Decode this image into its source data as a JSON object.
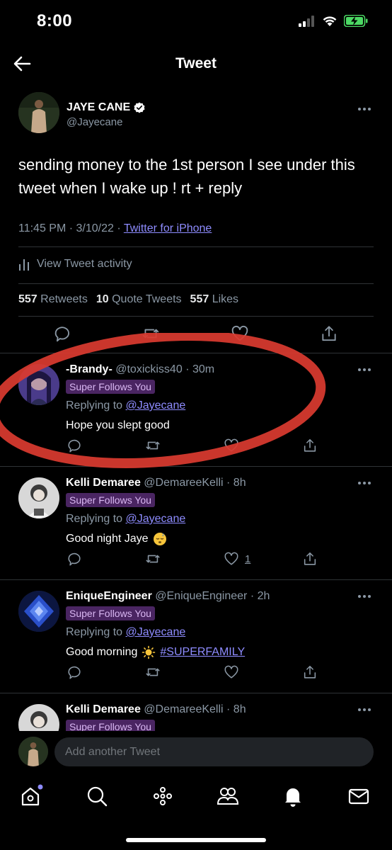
{
  "status_bar": {
    "time": "8:00"
  },
  "nav": {
    "title": "Tweet"
  },
  "tweet": {
    "author_name": "JAYE CANE",
    "author_handle": "@Jayecane",
    "text": "sending money to the 1st person I see under this tweet when I wake up ! rt + reply",
    "time_date": "11:45 PM · 3/10/22 · ",
    "source": "Twitter for iPhone",
    "activity_label": "View Tweet activity",
    "stats": {
      "retweets_count": "557",
      "retweets_label": "Retweets",
      "quotes_count": "10",
      "quotes_label": "Quote Tweets",
      "likes_count": "557",
      "likes_label": "Likes"
    }
  },
  "replies": [
    {
      "name": "-Brandy-",
      "handle": "@toxickiss40",
      "time": "· 30m",
      "badge": "Super Follows You",
      "replying_prefix": "Replying to ",
      "replying_to": "@Jayecane",
      "text": "Hope you slept good",
      "likes": ""
    },
    {
      "name": "Kelli Demaree",
      "handle": "@DemareeKelli",
      "time": "· 8h",
      "badge": "Super Follows You",
      "replying_prefix": "Replying to ",
      "replying_to": "@Jayecane",
      "text": "Good night Jaye",
      "likes": "1"
    },
    {
      "name": "EniqueEngineer",
      "handle": "@EniqueEngineer",
      "time": "· 2h",
      "badge": "Super Follows You",
      "replying_prefix": "Replying to ",
      "replying_to": "@Jayecane",
      "text": "Good morning",
      "hashtag": "#SUPERFAMILY",
      "likes": ""
    },
    {
      "name": "Kelli Demaree",
      "handle": "@DemareeKelli",
      "time": "· 8h",
      "badge": "Super Follows You"
    }
  ],
  "compose": {
    "placeholder": "Add another Tweet"
  },
  "tabs": [
    "home-icon",
    "search-icon",
    "spaces-icon",
    "communities-icon",
    "notifications-icon",
    "messages-icon"
  ],
  "colors": {
    "link": "#8e8cff",
    "badge_bg": "#4a2562",
    "annotation": "#d93a2f",
    "battery": "#4cd964"
  }
}
